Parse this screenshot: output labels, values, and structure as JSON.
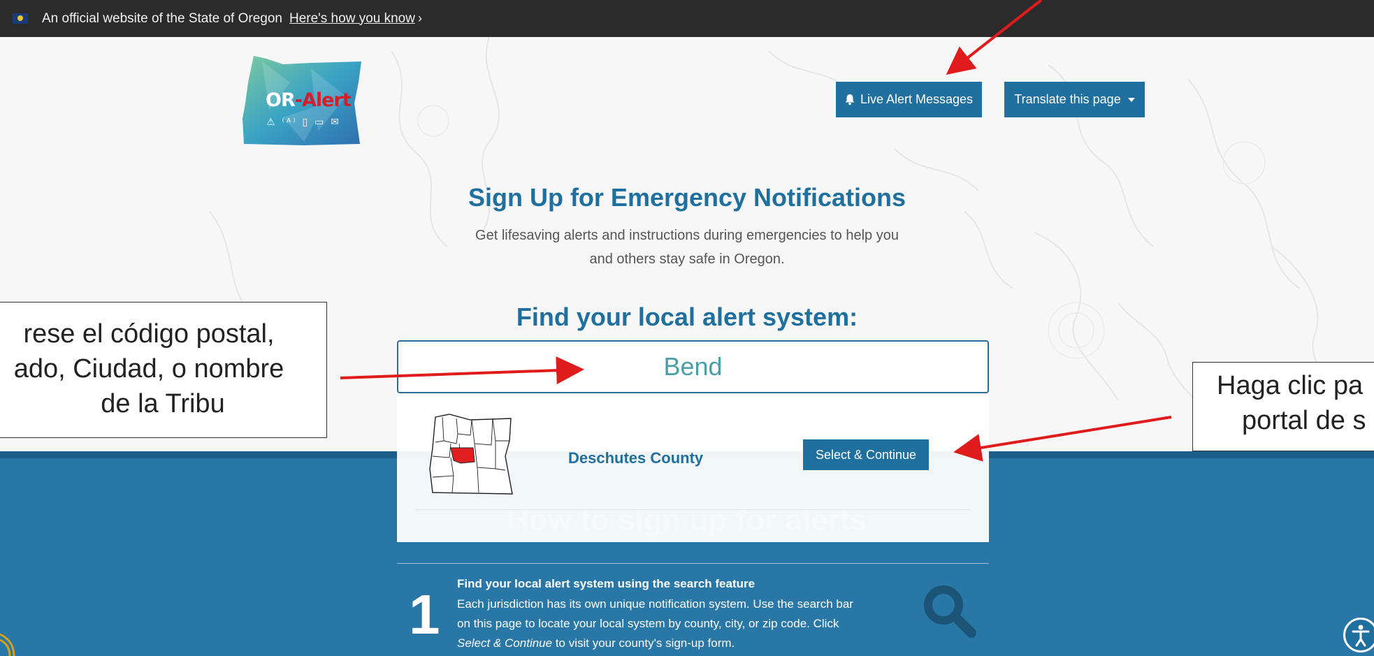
{
  "banner": {
    "text": "An official website of the State of Oregon",
    "link": "Here's how you know"
  },
  "logo": {
    "prefix": "OR",
    "suffix": "-Alert",
    "icons": "⚠ ⁽ᴬ⁾ ▯ ▭ ✉"
  },
  "header": {
    "live_alerts_label": "Live Alert Messages",
    "translate_label": "Translate this page"
  },
  "hero": {
    "title": "Sign Up for Emergency Notifications",
    "subtitle_line1": "Get lifesaving alerts and instructions during emergencies to help you",
    "subtitle_line2": "and others stay safe in Oregon.",
    "find_title": "Find your local alert system:"
  },
  "search": {
    "value": "Bend"
  },
  "result": {
    "county": "Deschutes County",
    "select_label": "Select & Continue"
  },
  "ghost_title": "How to sign up for alerts",
  "step1": {
    "number": "1",
    "title": "Find your local alert system using the search feature",
    "body_line1": "Each jurisdiction has its own unique notification system. Use the search bar",
    "body_line2": "on this page to locate your local system by county, city, or zip code. Click",
    "body_em": "Select & Continue",
    "body_rest": " to visit your county's sign-up form."
  },
  "annotations": {
    "left_line1": "rese el código postal,",
    "left_line2": "ado, Ciudad, o nombre",
    "left_line3": "de la Tribu",
    "right_line1": "Haga clic pa",
    "right_line2": "portal de s"
  },
  "colors": {
    "primary": "#1f6f9f",
    "section_blue": "#2977a6",
    "banner_dark": "#2b2b2b",
    "arrow_red": "#e01b1b",
    "logo_red": "#d21f2b"
  }
}
